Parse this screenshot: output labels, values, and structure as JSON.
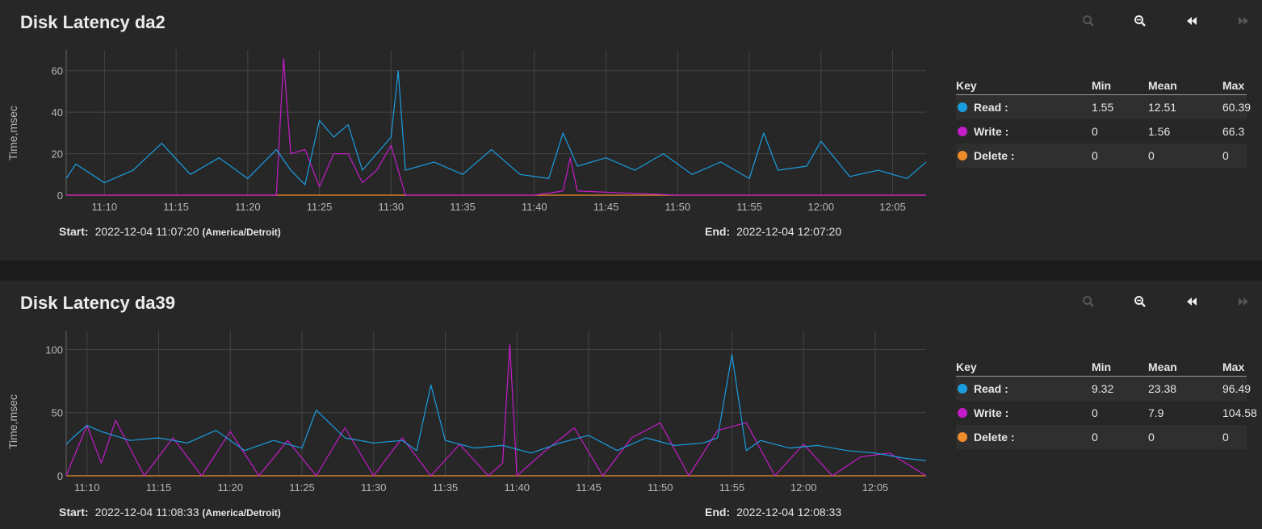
{
  "colors": {
    "read": "#1a9de0",
    "write": "#c41cc8",
    "delete": "#f08c2c",
    "grid": "#444444",
    "tick": "#b8b8b8"
  },
  "toolbar_icons": [
    "zoom-in-icon",
    "zoom-out-icon",
    "step-back-icon",
    "step-forward-icon"
  ],
  "panels": [
    {
      "title": "Disk Latency da2",
      "ylabel": "Time,msec",
      "start_label": "Start:",
      "start": "2022-12-04 11:07:20",
      "timezone": "(America/Detroit)",
      "end_label": "End:",
      "end": "2022-12-04 12:07:20",
      "legend": {
        "headers": [
          "Key",
          "Min",
          "Mean",
          "Max"
        ],
        "rows": [
          {
            "key": "Read :",
            "min": "1.55",
            "mean": "12.51",
            "max": "60.39"
          },
          {
            "key": "Write :",
            "min": "0",
            "mean": "1.56",
            "max": "66.3"
          },
          {
            "key": "Delete :",
            "min": "0",
            "mean": "0",
            "max": "0"
          }
        ]
      }
    },
    {
      "title": "Disk Latency da39",
      "ylabel": "Time,msec",
      "start_label": "Start:",
      "start": "2022-12-04 11:08:33",
      "timezone": "(America/Detroit)",
      "end_label": "End:",
      "end": "2022-12-04 12:08:33",
      "legend": {
        "headers": [
          "Key",
          "Min",
          "Mean",
          "Max"
        ],
        "rows": [
          {
            "key": "Read :",
            "min": "9.32",
            "mean": "23.38",
            "max": "96.49"
          },
          {
            "key": "Write :",
            "min": "0",
            "mean": "7.9",
            "max": "104.58"
          },
          {
            "key": "Delete :",
            "min": "0",
            "mean": "0",
            "max": "0"
          }
        ]
      }
    }
  ],
  "chart_data": [
    {
      "type": "line",
      "x_ticks": [
        "11:10",
        "11:15",
        "11:20",
        "11:25",
        "11:30",
        "11:35",
        "11:40",
        "11:45",
        "11:50",
        "11:55",
        "12:00",
        "12:05"
      ],
      "y_ticks": [
        0,
        20,
        40,
        60
      ],
      "ylim": [
        0,
        70
      ],
      "xlim": [
        "11:07:20",
        "12:07:20"
      ],
      "ylabel": "Time,msec",
      "grid": true,
      "series": [
        {
          "name": "Read",
          "x": [
            "11:07:20",
            "11:08",
            "11:10",
            "11:12",
            "11:14",
            "11:16",
            "11:18",
            "11:20",
            "11:22",
            "11:23",
            "11:24",
            "11:25",
            "11:26",
            "11:27",
            "11:28",
            "11:29",
            "11:30",
            "11:30:30",
            "11:31",
            "11:33",
            "11:35",
            "11:37",
            "11:39",
            "11:41",
            "11:42",
            "11:43",
            "11:45",
            "11:47",
            "11:49",
            "11:51",
            "11:53",
            "11:55",
            "11:56",
            "11:57",
            "11:59",
            "12:00",
            "12:02",
            "12:04",
            "12:06",
            "12:07:20"
          ],
          "values": [
            8,
            15,
            6,
            12,
            25,
            10,
            18,
            8,
            22,
            12,
            5,
            36,
            28,
            34,
            12,
            20,
            28,
            60,
            12,
            16,
            10,
            22,
            10,
            8,
            30,
            14,
            18,
            12,
            20,
            10,
            16,
            8,
            30,
            12,
            14,
            26,
            9,
            12,
            8,
            16
          ]
        },
        {
          "name": "Write",
          "x": [
            "11:07:20",
            "11:15",
            "11:20",
            "11:22",
            "11:22:30",
            "11:23",
            "11:24",
            "11:25",
            "11:26",
            "11:27",
            "11:28",
            "11:29",
            "11:30",
            "11:31",
            "11:35",
            "11:40",
            "11:42",
            "11:42:30",
            "11:43",
            "11:50",
            "12:00",
            "12:07:20"
          ],
          "values": [
            0,
            0,
            0,
            0,
            66,
            20,
            22,
            4,
            20,
            20,
            6,
            12,
            24,
            0,
            0,
            0,
            2,
            18,
            2,
            0,
            0,
            0
          ]
        },
        {
          "name": "Delete",
          "x": [
            "11:07:20",
            "12:07:20"
          ],
          "values": [
            0,
            0
          ]
        }
      ]
    },
    {
      "type": "line",
      "x_ticks": [
        "11:10",
        "11:15",
        "11:20",
        "11:25",
        "11:30",
        "11:35",
        "11:40",
        "11:45",
        "11:50",
        "11:55",
        "12:00",
        "12:05"
      ],
      "y_ticks": [
        0,
        50,
        100
      ],
      "ylim": [
        0,
        115
      ],
      "xlim": [
        "11:08:33",
        "12:08:33"
      ],
      "ylabel": "Time,msec",
      "grid": true,
      "series": [
        {
          "name": "Read",
          "x": [
            "11:08:33",
            "11:09",
            "11:10",
            "11:11",
            "11:13",
            "11:15",
            "11:17",
            "11:19",
            "11:21",
            "11:23",
            "11:25",
            "11:26",
            "11:28",
            "11:30",
            "11:32",
            "11:33",
            "11:34",
            "11:35",
            "11:37",
            "11:39",
            "11:41",
            "11:43",
            "11:45",
            "11:47",
            "11:49",
            "11:51",
            "11:53",
            "11:54",
            "11:55",
            "11:56",
            "11:57",
            "11:59",
            "12:01",
            "12:03",
            "12:05",
            "12:07",
            "12:08:33"
          ],
          "values": [
            25,
            30,
            40,
            35,
            28,
            30,
            26,
            36,
            20,
            28,
            22,
            52,
            30,
            26,
            28,
            20,
            72,
            28,
            22,
            24,
            18,
            26,
            32,
            20,
            30,
            24,
            26,
            30,
            96,
            20,
            28,
            22,
            24,
            20,
            18,
            14,
            12
          ]
        },
        {
          "name": "Write",
          "x": [
            "11:08:33",
            "11:10",
            "11:11",
            "11:12",
            "11:14",
            "11:16",
            "11:18",
            "11:20",
            "11:22",
            "11:24",
            "11:26",
            "11:28",
            "11:30",
            "11:32",
            "11:34",
            "11:36",
            "11:38",
            "11:39",
            "11:39:30",
            "11:40",
            "11:42",
            "11:44",
            "11:46",
            "11:48",
            "11:50",
            "11:52",
            "11:54",
            "11:56",
            "11:58",
            "12:00",
            "12:02",
            "12:04",
            "12:06",
            "12:08:33"
          ],
          "values": [
            0,
            40,
            10,
            44,
            0,
            30,
            0,
            35,
            0,
            28,
            0,
            38,
            0,
            30,
            0,
            25,
            0,
            10,
            104,
            0,
            20,
            38,
            0,
            30,
            42,
            0,
            36,
            42,
            0,
            25,
            0,
            15,
            18,
            0
          ]
        },
        {
          "name": "Delete",
          "x": [
            "11:08:33",
            "12:08:33"
          ],
          "values": [
            0,
            0
          ]
        }
      ]
    }
  ]
}
